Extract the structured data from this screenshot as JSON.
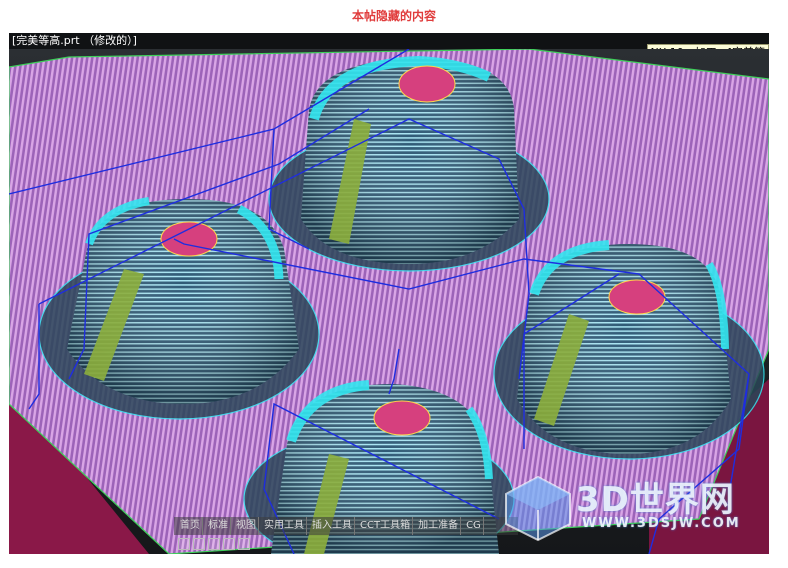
{
  "notice": {
    "text": "本帖隐藏的内容"
  },
  "window": {
    "doc_title": "[完美等高.prt （修改的）]",
    "app_title": "NX 10 - 加工 - [完美等"
  },
  "toolbar": {
    "items": [
      "首页",
      "标准",
      "视图",
      "实用工具",
      "插入工具",
      "CCT工具箱",
      "加工准备",
      "CG"
    ]
  },
  "watermark": {
    "brand": "3D世界网",
    "url": "WWW.3DSJW.COM"
  },
  "colors": {
    "background": "#1c1f23",
    "toolpath_stripes": "#c98ad8",
    "contour_lines": "#33e6f0",
    "top_face": "#d6407e",
    "non_cut_moves": "#1e2de0",
    "base_block": "#8a1848"
  }
}
